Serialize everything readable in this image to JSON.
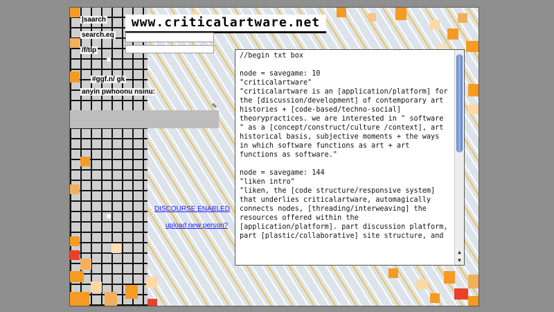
{
  "site": {
    "title": "www.criticalartware.net"
  },
  "nav": {
    "item1": "|saarch",
    "item2": "search.eq",
    "item3": "/f/tlp",
    "item4": "#ggf.n/ gk",
    "item5": "anyin pwhoonu nsinu:"
  },
  "sidebar": {
    "discourse_link": "DISCOURSE ENABLED",
    "upload_link": "upload new person?"
  },
  "textbox": {
    "content": "//begin txt box\n\nnode = savegame: 10\n\"criticalartware\"\n\"criticalartware is an [application/platform] for the [discussion/development] of contemporary art histories + [code-based/techno-social] theorypractices. we are interested in \" software \" as a [concept/construct/culture /context], art historical basis, subjective moments + the ways in which software functions as art + art functions as software.\"\n\nnode = savegame: 144\n\"liken intro\"\n\"liken, the [code structure/responsive system] that underlies criticalartware, automagically connects nodes, [threading/interweaving] the resources offered within the [application/platform]. part discussion platform, part [plastic/collaborative] site structure, and"
  },
  "colors": {
    "background_gray": "#8f8f8f",
    "stripe_gold": "#f0c34f",
    "pixel_orange": "#f59a23",
    "pixel_red": "#e8402a",
    "link_blue": "#1a1aff",
    "scroll_blue": "#5a7fc6"
  },
  "icons": {
    "pencil": "pencil-icon",
    "scroll_up": "arrow-up-icon",
    "scroll_down": "arrow-down-icon"
  }
}
